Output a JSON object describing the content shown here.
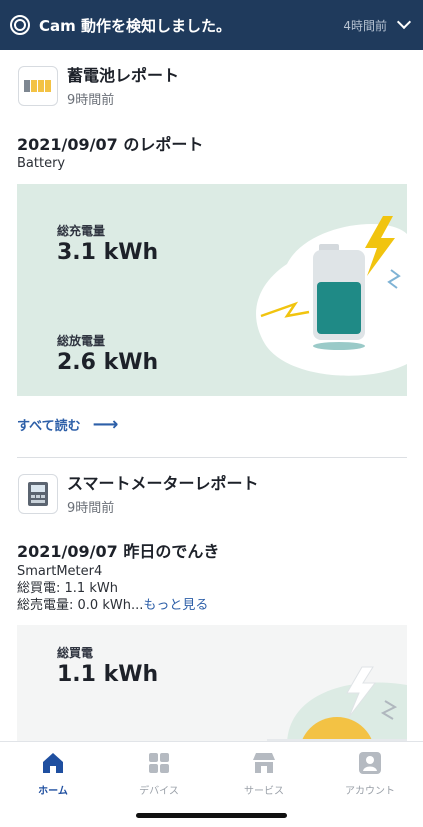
{
  "banner": {
    "title": "Cam 動作を検知しました。",
    "time": "4時間前"
  },
  "battery_report": {
    "app_name": "蓄電池レポート",
    "time_ago": "9時間前",
    "title": "2021/09/07 のレポート",
    "subtitle": "Battery",
    "charge_label": "総充電量",
    "charge_value": "3.1 kWh",
    "discharge_label": "総放電量",
    "discharge_value": "2.6 kWh",
    "read_all": "すべて読む",
    "read_all_arrow": "⟶"
  },
  "smart_meter_report": {
    "app_name": "スマートメーターレポート",
    "time_ago": "9時間前",
    "title": "2021/09/07 昨日のでんき",
    "device": "SmartMeter4",
    "buy_line": "総買電: 1.1 kWh",
    "sell_line": "総売電量: 0.0 kWh...",
    "see_more": "もっと見る",
    "panel_label": "総買電",
    "panel_value": "1.1 kWh"
  },
  "tabs": [
    {
      "label": "ホーム",
      "icon": "home-icon",
      "active": true
    },
    {
      "label": "デバイス",
      "icon": "devices-grid-icon",
      "active": false
    },
    {
      "label": "サービス",
      "icon": "store-icon",
      "active": false
    },
    {
      "label": "アカウント",
      "icon": "account-icon",
      "active": false
    }
  ],
  "colors": {
    "banner_bg": "#1f3a5c",
    "accent_blue": "#2d5fa8",
    "battery_panel_bg": "#dcebe4",
    "battery_fill": "#1f8a86",
    "bolt_yellow": "#f1c40f"
  }
}
